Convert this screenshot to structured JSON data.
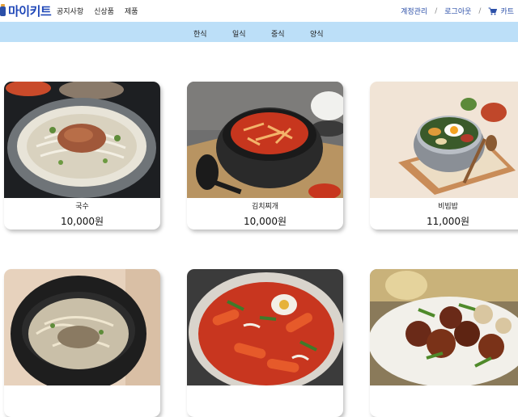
{
  "logo": {
    "text": "마이키트"
  },
  "nav": {
    "left": [
      "공지사항",
      "신상품",
      "제품"
    ],
    "account": "계정관리",
    "logout": "로그아웃",
    "cart": "카트",
    "separator": "/"
  },
  "categories": [
    "한식",
    "일식",
    "중식",
    "양식"
  ],
  "products": [
    {
      "name": "국수",
      "price": "10,000원"
    },
    {
      "name": "김치찌개",
      "price": "10,000원"
    },
    {
      "name": "비빔밥",
      "price": "11,000원"
    },
    {
      "name": "",
      "price": ""
    },
    {
      "name": "",
      "price": ""
    },
    {
      "name": "",
      "price": ""
    }
  ],
  "colors": {
    "accent": "#2b4fa8",
    "category_bar": "#bcdff8"
  },
  "icons": {
    "cart": "cart-icon",
    "logo": "jar-logo-icon"
  }
}
